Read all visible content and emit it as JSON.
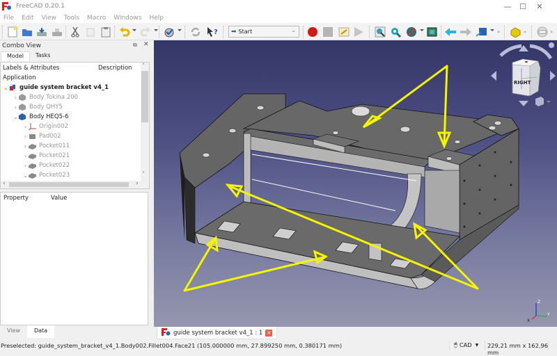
{
  "window": {
    "title": "FreeCAD 0.20.1",
    "controls": {
      "minimize": "—",
      "maximize": "☐",
      "close": "✕"
    }
  },
  "menu": [
    "File",
    "Edit",
    "View",
    "Tools",
    "Macro",
    "Windows",
    "Help"
  ],
  "toolbar": {
    "workbench_selector": "Start",
    "icons": [
      "new-file",
      "open-file",
      "save",
      "save-as",
      "cut",
      "copy",
      "paste",
      "undo",
      "redo",
      "workbench-check",
      "refresh",
      "whats-this",
      "macro-record",
      "macro-stop",
      "macro-edit",
      "macro-run",
      "fit-all",
      "fit-selection",
      "draw-style",
      "bounding-box",
      "nav-back",
      "nav-forward",
      "std-views",
      "part-box",
      "close-toolbar"
    ]
  },
  "combo_view": {
    "title": "Combo View",
    "tabs": [
      "Model",
      "Tasks"
    ],
    "active_tab": "Model",
    "tree": {
      "columns": [
        "Labels & Attributes",
        "Description"
      ],
      "root_label": "Application",
      "items": [
        {
          "label": "guide system bracket v4_1",
          "level": 0,
          "expanded": true,
          "bold": true,
          "icon": "document"
        },
        {
          "label": "Body Tokina 200",
          "level": 1,
          "expanded": false,
          "icon": "body-grey",
          "dim": true
        },
        {
          "label": "Body QHY5",
          "level": 1,
          "expanded": false,
          "icon": "body-grey",
          "dim": true
        },
        {
          "label": "Body HEQ5-6",
          "level": 1,
          "expanded": true,
          "icon": "body-blue"
        },
        {
          "label": "Origin002",
          "level": 2,
          "expanded": false,
          "icon": "origin",
          "dim": true
        },
        {
          "label": "Pad002",
          "level": 2,
          "expanded": false,
          "icon": "pad",
          "dim": true
        },
        {
          "label": "Pocket011",
          "level": 2,
          "expanded": false,
          "icon": "pocket",
          "dim": true
        },
        {
          "label": "Pocket021",
          "level": 2,
          "expanded": false,
          "icon": "pocket",
          "dim": true
        },
        {
          "label": "Pocket022",
          "level": 2,
          "expanded": false,
          "icon": "pocket",
          "dim": true
        },
        {
          "label": "Pocket023",
          "level": 2,
          "expanded": true,
          "icon": "pocket",
          "dim": true
        }
      ]
    },
    "properties": {
      "columns": [
        "Property",
        "Value"
      ]
    },
    "bottom_tabs": [
      "View",
      "Data"
    ],
    "active_bottom_tab": "Data"
  },
  "viewport": {
    "navcube_face": "RIGHT",
    "axis_labels": {
      "x": "X",
      "y": "Y",
      "z": "Z"
    },
    "annotation_color": "#f5f500"
  },
  "document_tab": {
    "label": "guide system bracket v4_1 : 1"
  },
  "statusbar": {
    "message": "Preselected: guide_system_bracket_v4_1.Body002.Fillet004.Face21 (105.000000 mm, 27.899250 mm, 0.380171 mm)",
    "nav_style": "CAD",
    "dimensions": "229,21 mm x 162,96 mm"
  },
  "colors": {
    "accent_red": "#d42020",
    "viewport_top": "#343668",
    "viewport_bottom": "#9596ae",
    "model_grey": "#6b6b6b"
  }
}
